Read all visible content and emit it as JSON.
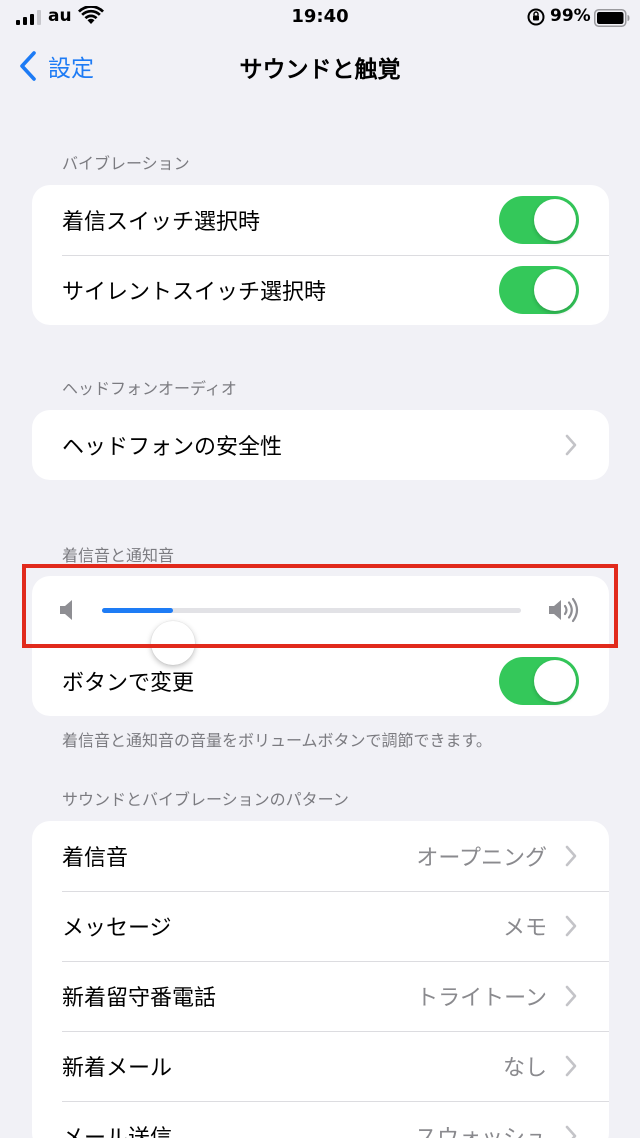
{
  "status_bar": {
    "carrier": "au",
    "time": "19:40",
    "battery_percent": "99%"
  },
  "nav": {
    "back_label": "設定",
    "title": "サウンドと触覚"
  },
  "vibration": {
    "header": "バイブレーション",
    "items": [
      {
        "label": "着信スイッチ選択時",
        "on": true
      },
      {
        "label": "サイレントスイッチ選択時",
        "on": true
      }
    ]
  },
  "headphone": {
    "header": "ヘッドフォンオーディオ",
    "safety_label": "ヘッドフォンの安全性"
  },
  "ringer": {
    "header": "着信音と通知音",
    "volume_level": 0.17,
    "change_with_buttons_label": "ボタンで変更",
    "change_with_buttons_on": true,
    "footer": "着信音と通知音の音量をボリュームボタンで調節できます。"
  },
  "patterns": {
    "header": "サウンドとバイブレーションのパターン",
    "items": [
      {
        "label": "着信音",
        "value": "オープニング"
      },
      {
        "label": "メッセージ",
        "value": "メモ"
      },
      {
        "label": "新着留守番電話",
        "value": "トライトーン"
      },
      {
        "label": "新着メール",
        "value": "なし"
      },
      {
        "label": "メール送信",
        "value": "スウォッシュ"
      }
    ]
  },
  "colors": {
    "accent": "#1e7cf5",
    "toggle_on": "#34c85a",
    "highlight": "#e12a1c"
  }
}
